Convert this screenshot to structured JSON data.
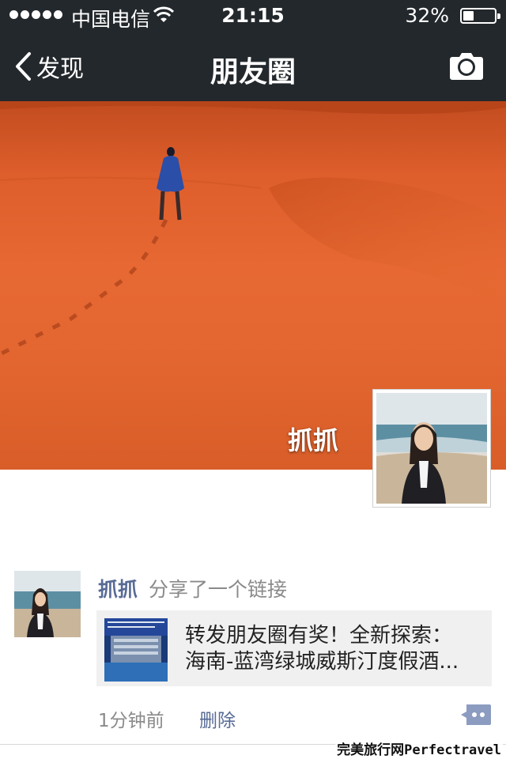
{
  "status_bar": {
    "carrier": "中国电信",
    "time": "21:15",
    "battery_percent": "32%",
    "battery_level": 0.32,
    "signal_dots": 5
  },
  "nav": {
    "back_label": "发现",
    "title": "朋友圈",
    "camera_icon": "camera-icon"
  },
  "profile": {
    "name": "抓抓"
  },
  "post": {
    "author": "抓抓",
    "action": "分享了一个链接",
    "link": {
      "line1": "转发朋友圈有奖！全新探索：",
      "line2": "海南-蓝湾绿城威斯汀度假酒..."
    },
    "time": "1分钟前",
    "delete_label": "删除"
  },
  "watermark": "完美旅行网Perfectravel",
  "colors": {
    "bar_bg": "#23282c",
    "link_blue": "#576b95",
    "card_bg": "#f0f0f0",
    "cover_orange": "#e36630"
  }
}
